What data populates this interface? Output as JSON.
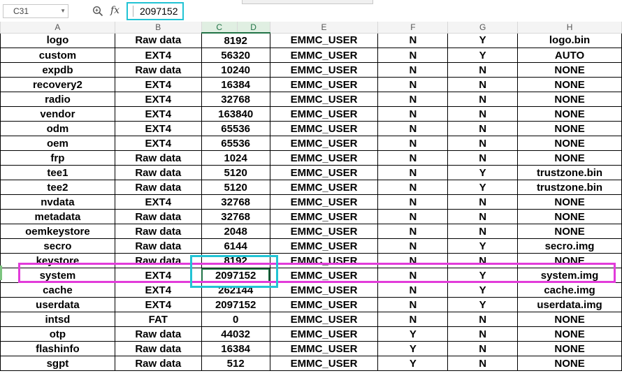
{
  "formula_bar": {
    "name_box": "C31",
    "fx_label": "fx",
    "formula_value": "2097152"
  },
  "columns": [
    "A",
    "B",
    "C",
    "D",
    "E",
    "F",
    "G",
    "H"
  ],
  "rows": [
    [
      "logo",
      "Raw data",
      "8192",
      "EMMC_USER",
      "N",
      "Y",
      "logo.bin"
    ],
    [
      "custom",
      "EXT4",
      "56320",
      "EMMC_USER",
      "N",
      "Y",
      "AUTO"
    ],
    [
      "expdb",
      "Raw data",
      "10240",
      "EMMC_USER",
      "N",
      "N",
      "NONE"
    ],
    [
      "recovery2",
      "EXT4",
      "16384",
      "EMMC_USER",
      "N",
      "N",
      "NONE"
    ],
    [
      "radio",
      "EXT4",
      "32768",
      "EMMC_USER",
      "N",
      "N",
      "NONE"
    ],
    [
      "vendor",
      "EXT4",
      "163840",
      "EMMC_USER",
      "N",
      "N",
      "NONE"
    ],
    [
      "odm",
      "EXT4",
      "65536",
      "EMMC_USER",
      "N",
      "N",
      "NONE"
    ],
    [
      "oem",
      "EXT4",
      "65536",
      "EMMC_USER",
      "N",
      "N",
      "NONE"
    ],
    [
      "frp",
      "Raw data",
      "1024",
      "EMMC_USER",
      "N",
      "N",
      "NONE"
    ],
    [
      "tee1",
      "Raw data",
      "5120",
      "EMMC_USER",
      "N",
      "Y",
      "trustzone.bin"
    ],
    [
      "tee2",
      "Raw data",
      "5120",
      "EMMC_USER",
      "N",
      "Y",
      "trustzone.bin"
    ],
    [
      "nvdata",
      "EXT4",
      "32768",
      "EMMC_USER",
      "N",
      "N",
      "NONE"
    ],
    [
      "metadata",
      "Raw data",
      "32768",
      "EMMC_USER",
      "N",
      "N",
      "NONE"
    ],
    [
      "oemkeystore",
      "Raw data",
      "2048",
      "EMMC_USER",
      "N",
      "N",
      "NONE"
    ],
    [
      "secro",
      "Raw data",
      "6144",
      "EMMC_USER",
      "N",
      "Y",
      "secro.img"
    ],
    [
      "keystore",
      "Raw data",
      "8192",
      "EMMC_USER",
      "N",
      "N",
      "NONE"
    ],
    [
      "system",
      "EXT4",
      "2097152",
      "EMMC_USER",
      "N",
      "Y",
      "system.img"
    ],
    [
      "cache",
      "EXT4",
      "262144",
      "EMMC_USER",
      "N",
      "Y",
      "cache.img"
    ],
    [
      "userdata",
      "EXT4",
      "2097152",
      "EMMC_USER",
      "N",
      "Y",
      "userdata.img"
    ],
    [
      "intsd",
      "FAT",
      "0",
      "EMMC_USER",
      "N",
      "N",
      "NONE"
    ],
    [
      "otp",
      "Raw data",
      "44032",
      "EMMC_USER",
      "Y",
      "N",
      "NONE"
    ],
    [
      "flashinfo",
      "Raw data",
      "16384",
      "EMMC_USER",
      "Y",
      "N",
      "NONE"
    ],
    [
      "sgpt",
      "Raw data",
      "512",
      "EMMC_USER",
      "Y",
      "N",
      "NONE"
    ]
  ],
  "selection": {
    "row_label": "system"
  },
  "colors": {
    "accent_green": "#217346",
    "highlight_cyan": "#22c3d4",
    "highlight_magenta": "#e23bda"
  }
}
